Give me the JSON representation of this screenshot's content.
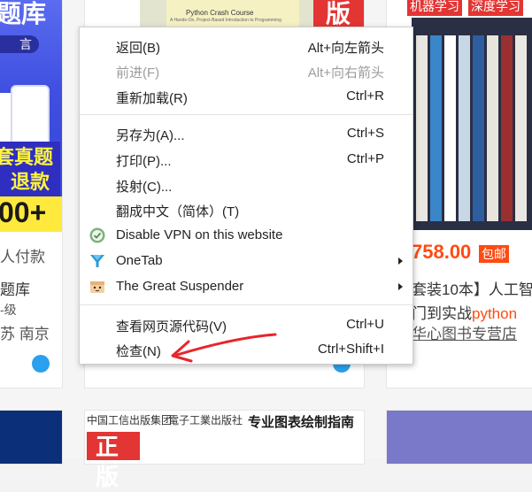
{
  "background": {
    "left_promo": {
      "title": "题库",
      "pill_text": "言",
      "tag_line1": "套真题",
      "tag_line2": "退款",
      "number": "00+",
      "lines": [
        "人付款",
        "题库",
        "-级",
        "苏 南京"
      ]
    },
    "middle_book": {
      "cover_title": "Python Crash Course",
      "cover_subtitle": "A Hands-On, Project-Based Introduction to Programming",
      "red_text": "版"
    },
    "right_product": {
      "top_tags": [
        "机器学习",
        "深度学习"
      ],
      "price": "758.00",
      "badge": "包邮",
      "line1": "套装10本】人工智",
      "line2_prefix": "门到实战",
      "line2_highlight": "python",
      "line3": "华心图书专营店"
    },
    "bottom_middle": {
      "logo1": "中国工信出版集团",
      "logo2": "電子工業出版社",
      "label": "专业图表绘制指南",
      "red_text": "正版"
    }
  },
  "context_menu": {
    "items": [
      {
        "label": "返回(B)",
        "shortcut": "Alt+向左箭头",
        "enabled": true
      },
      {
        "label": "前进(F)",
        "shortcut": "Alt+向右箭头",
        "enabled": false
      },
      {
        "label": "重新加载(R)",
        "shortcut": "Ctrl+R",
        "enabled": true
      },
      {
        "label": "另存为(A)...",
        "shortcut": "Ctrl+S",
        "enabled": true
      },
      {
        "label": "打印(P)...",
        "shortcut": "Ctrl+P",
        "enabled": true
      },
      {
        "label": "投射(C)...",
        "shortcut": "",
        "enabled": true
      },
      {
        "label": "翻成中文（简体）(T)",
        "shortcut": "",
        "enabled": true
      },
      {
        "label": "Disable VPN on this website",
        "shortcut": "",
        "enabled": true,
        "icon": "vpn-shield-icon"
      },
      {
        "label": "OneTab",
        "shortcut": "",
        "enabled": true,
        "icon": "onetab-funnel-icon",
        "submenu": true
      },
      {
        "label": "The Great Suspender",
        "shortcut": "",
        "enabled": true,
        "icon": "suspender-face-icon",
        "submenu": true
      },
      {
        "label": "查看网页源代码(V)",
        "shortcut": "Ctrl+U",
        "enabled": true
      },
      {
        "label": "检查(N)",
        "shortcut": "Ctrl+Shift+I",
        "enabled": true
      }
    ]
  },
  "annotation": {
    "kind": "red-hand-drawn-arrow",
    "color": "#e8252a",
    "points_to": "检查(N)"
  }
}
